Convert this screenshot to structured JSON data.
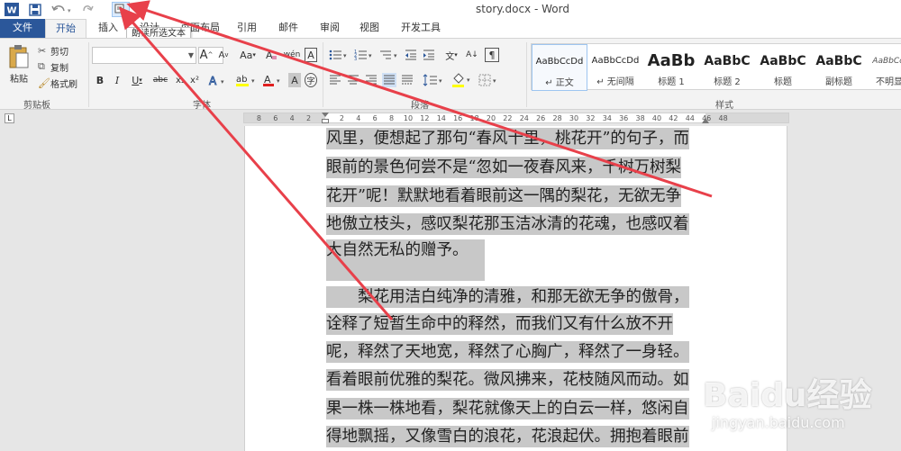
{
  "window": {
    "title": "story.docx - Word"
  },
  "quick_access": {
    "word_icon": "word-logo-icon",
    "save_icon": "save-icon",
    "undo_icon": "undo-icon",
    "redo_icon": "redo-icon",
    "read_icon": "read-aloud-icon"
  },
  "tooltip": {
    "text": "朗读所选文本"
  },
  "tabs": {
    "file": "文件",
    "home": "开始",
    "insert": "插入",
    "design": "设计",
    "layout": "页面布局",
    "references": "引用",
    "mailings": "邮件",
    "review": "审阅",
    "view": "视图",
    "developer": "开发工具"
  },
  "clipboard": {
    "paste": "粘贴",
    "cut": "剪切",
    "copy": "复制",
    "format_painter": "格式刷",
    "group_label": "剪贴板"
  },
  "font": {
    "name_value": "",
    "size_value": "",
    "bold": "B",
    "italic": "I",
    "underline": "U",
    "strike": "abc",
    "subscript": "x₂",
    "superscript": "x²",
    "change_case": "Aa",
    "grow": "A",
    "shrink": "A",
    "group_label": "字体"
  },
  "paragraph": {
    "group_label": "段落"
  },
  "styles": {
    "group_label": "样式",
    "items": [
      {
        "sample": "AaBbCcDd",
        "name": "↵ 正文"
      },
      {
        "sample": "AaBbCcDd",
        "name": "↵ 无间隔"
      },
      {
        "sample": "AaBb",
        "name": "标题 1"
      },
      {
        "sample": "AaBbC",
        "name": "标题 2"
      },
      {
        "sample": "AaBbC",
        "name": "标题"
      },
      {
        "sample": "AaBbC",
        "name": "副标题"
      },
      {
        "sample": "AaBbCcDd",
        "name": "不明显强"
      }
    ]
  },
  "ruler": {
    "left_numbers": [
      "8",
      "6",
      "4",
      "2"
    ],
    "right_numbers": [
      "2",
      "4",
      "6",
      "8",
      "10",
      "12",
      "14",
      "16",
      "18",
      "20",
      "22",
      "24",
      "26",
      "28",
      "30",
      "32",
      "34",
      "36",
      "38",
      "40",
      "42",
      "44",
      "46",
      "48"
    ]
  },
  "document": {
    "lines": [
      "风里，便想起了那句“春风十里，桃花开”的句子，而",
      "眼前的景色何尝不是“忽如一夜春风来，千树万树梨",
      "花开”呢！默默地看着眼前这一隅的梨花，无欲无争",
      "地傲立枝头，感叹梨花那玉洁冰清的花魂，也感叹着",
      "大自然无私的赠予。",
      "",
      "　　梨花用洁白纯净的清雅，和那无欲无争的傲骨，",
      "诠释了短暂生命中的释然，而我们又有什么放不开",
      "呢，释然了天地宽，释然了心胸广，释然了一身轻。",
      "看着眼前优雅的梨花。微风拂来，花枝随风而动。如",
      "果一株一株地看，梨花就像天上的白云一样，悠闲自",
      "得地飘摇，又像雪白的浪花，花浪起伏。拥抱着眼前"
    ]
  },
  "watermark": {
    "logo": "Baidu经验",
    "url": "jingyan.baidu.com"
  },
  "colors": {
    "accent": "#2b579a",
    "annotation_arrow": "#e8404a",
    "selection": "#c8c8c8",
    "highlight_swatch": "#ffff00",
    "font_color_swatch": "#e02020"
  }
}
